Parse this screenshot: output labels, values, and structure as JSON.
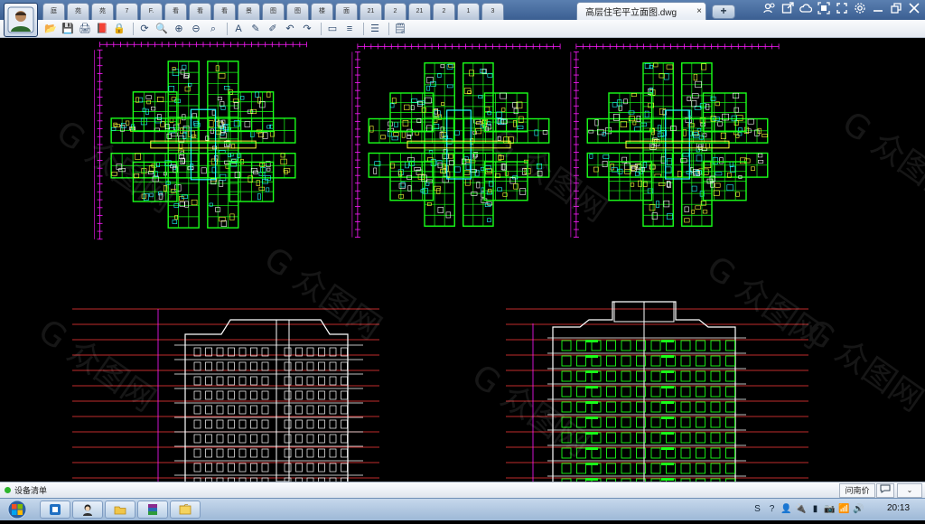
{
  "window": {
    "active_tab_title": "高层住宅平立面图.dwg",
    "active_tab_close": "×",
    "new_tab_label": "+",
    "inactive_tabs": [
      "庭",
      "苑",
      "苑",
      "7",
      "F.",
      "看",
      "看",
      "看",
      "景",
      "图",
      "图",
      "楼",
      "面",
      "21",
      "2",
      "21",
      "2",
      "1",
      "3"
    ],
    "window_controls": [
      "people-icon",
      "share-icon",
      "cloud-icon",
      "scan-icon",
      "fullscreen-icon",
      "settings-icon",
      "minimize-icon",
      "restore-icon",
      "close-icon"
    ]
  },
  "toolbar": {
    "tools": [
      {
        "icon": "open-folder-icon",
        "glyph": "📂"
      },
      {
        "icon": "save-icon",
        "glyph": "💾"
      },
      {
        "icon": "print-icon",
        "glyph": "🖨"
      },
      {
        "icon": "pdf-export-icon",
        "glyph": "📕"
      },
      {
        "icon": "lock-icon",
        "glyph": "🔒"
      },
      {
        "sep": true
      },
      {
        "icon": "rotate-view-icon",
        "glyph": "⟳"
      },
      {
        "icon": "zoom-window-icon",
        "glyph": "🔍"
      },
      {
        "icon": "zoom-in-icon",
        "glyph": "⊕"
      },
      {
        "icon": "zoom-out-icon",
        "glyph": "⊖"
      },
      {
        "icon": "zoom-extents-icon",
        "glyph": "⌕"
      },
      {
        "sep": true
      },
      {
        "icon": "text-icon",
        "glyph": "A"
      },
      {
        "icon": "pencil-icon",
        "glyph": "✎"
      },
      {
        "icon": "highlighter-icon",
        "glyph": "✐"
      },
      {
        "icon": "undo-icon",
        "glyph": "↶"
      },
      {
        "icon": "redo-icon",
        "glyph": "↷"
      },
      {
        "sep": true
      },
      {
        "icon": "measure-icon",
        "glyph": "▭"
      },
      {
        "icon": "measure-area-icon",
        "glyph": "≡"
      },
      {
        "sep": true
      },
      {
        "icon": "layers-icon",
        "glyph": "☰"
      },
      {
        "sep": true
      },
      {
        "icon": "document-icon",
        "glyph": "🗒"
      }
    ]
  },
  "status": {
    "text": "设备清单",
    "help_label": "问南价",
    "chat_icon": "chat-icon",
    "collapse_label": "⌄"
  },
  "taskbar": {
    "start_icon": "windows-start-icon",
    "tasks": [
      "app-blue-icon",
      "avatar-app-icon",
      "explorer-icon",
      "winrar-icon",
      "folder-icon"
    ],
    "tray": [
      "S",
      "?",
      "👤",
      "🔌",
      "▮",
      "📷",
      "📶",
      "🔊"
    ],
    "clock": "20:13"
  },
  "colors": {
    "plan_green": "#19ff19",
    "dim_magenta": "#ff1aff",
    "wall_yellow": "#ffff3a",
    "cyan": "#22ffff",
    "red_grid": "#ff3b3b",
    "white": "#ffffff"
  }
}
